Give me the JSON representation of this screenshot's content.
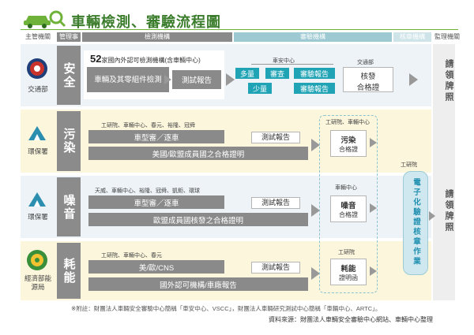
{
  "title": "車輛檢測、審驗流程圖",
  "headers": {
    "authority": "主管機關",
    "management": "管理事項",
    "testing": "檢測機構",
    "review": "審驗機構",
    "approval": "核章機構",
    "supervision": "監理機關"
  },
  "rows": [
    {
      "ministry": "交通部",
      "category": "安全",
      "institutions_count": "52",
      "institutions_text": "家國內外認可檢測機構(含車輛中心)",
      "parts_label": "車輛及其零組件檢測",
      "report_label": "測試報告",
      "center_label": "車安中心",
      "many": "多量",
      "review": "審查",
      "review_report_1": "審驗報告",
      "few": "少量",
      "review_report_2": "審驗報告",
      "ministry_label": "交通部",
      "approve_title": "核發",
      "approve_sub": "合格證"
    },
    {
      "ministry": "環保署",
      "category": "污染",
      "orgs": "工研院、車輛中心、春元、裕隆、冠舜",
      "vehicle_label": "車型審／逐車",
      "report_label": "測試報告",
      "foreign_label": "美國/歐盟成員國之合格證明",
      "right_orgs": "工研院、車輛中心",
      "cert_title": "污染",
      "cert_sub": "合格證"
    },
    {
      "ministry": "環保署",
      "category": "噪音",
      "orgs": "天威、車輛中心、裕隆、冠舜、凱鉅、環球",
      "vehicle_label": "車型審／逐車",
      "report_label": "測試報告",
      "foreign_label": "歐盟成員國核發之合格證明",
      "right_orgs": "車輛中心",
      "cert_title": "噪音",
      "cert_sub": "合格證"
    },
    {
      "ministry": "經濟部能源局",
      "category": "耗能",
      "orgs": "工研院、車輛中心、春元",
      "vehicle_label": "美/歐/CNS",
      "report_label": "測試報告",
      "foreign_label": "國外認可機構/車廠報告",
      "right_orgs": "工研院",
      "cert_title": "耗能",
      "cert_sub": "證明函"
    }
  ],
  "itri_label": "工研院",
  "electronic_label": "電子化驗證核章作業",
  "license_label": "請領牌照",
  "footnote": "※附註：財團法人車輛安全審驗中心簡稱「車安中心、VSCC」，財團法人車輛研究測試中心簡稱「車輛中心、ARTC」。",
  "source": "資料來源：財團法人車輛安全審驗中心網站、車輛中心整理",
  "colors": {
    "green": "#3b7d2c",
    "teal": "#1fa3b5",
    "gray": "#8a8a8a"
  }
}
